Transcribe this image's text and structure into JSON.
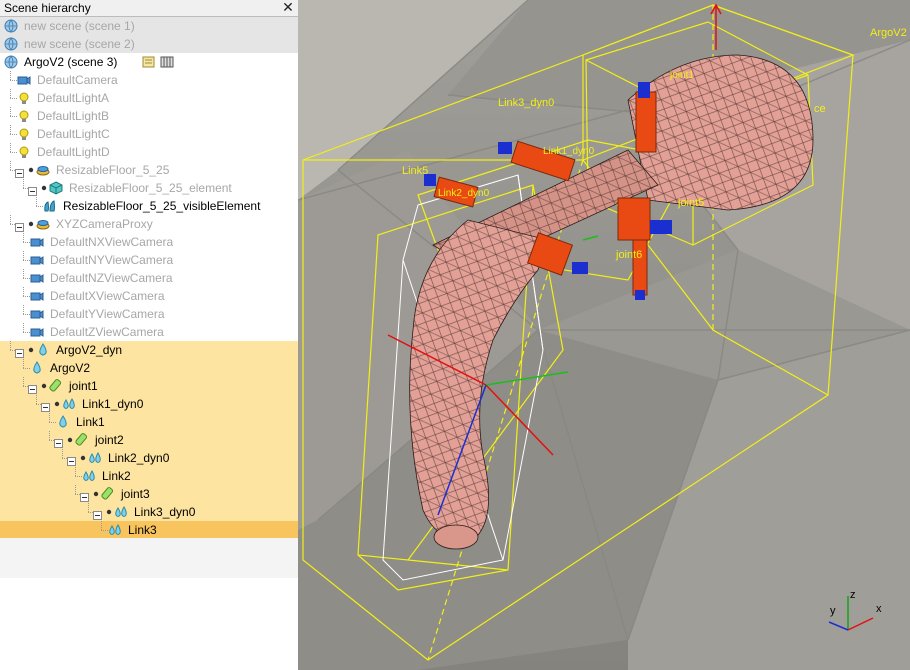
{
  "panel": {
    "title": "Scene hierarchy",
    "close": "✕"
  },
  "tree": [
    {
      "label": "new scene (scene 1)",
      "icon": "globe-icon",
      "level": 0,
      "dim": true,
      "bg": "grey"
    },
    {
      "label": "new scene (scene 2)",
      "icon": "globe-icon",
      "level": 0,
      "dim": true,
      "bg": "grey"
    },
    {
      "label": "ArgoV2 (scene 3)",
      "icon": "globe-icon",
      "level": 0,
      "dim": false,
      "bg": "",
      "extras": true
    },
    {
      "label": "DefaultCamera",
      "icon": "camera-icon",
      "level": 1,
      "dim": true,
      "bg": ""
    },
    {
      "label": "DefaultLightA",
      "icon": "light-icon",
      "level": 1,
      "dim": true,
      "bg": ""
    },
    {
      "label": "DefaultLightB",
      "icon": "light-icon",
      "level": 1,
      "dim": true,
      "bg": ""
    },
    {
      "label": "DefaultLightC",
      "icon": "light-icon",
      "level": 1,
      "dim": true,
      "bg": ""
    },
    {
      "label": "DefaultLightD",
      "icon": "light-icon",
      "level": 1,
      "dim": true,
      "bg": ""
    },
    {
      "label": "ResizableFloor_5_25",
      "icon": "floor-icon",
      "level": 1,
      "dim": true,
      "bg": "",
      "exp": true
    },
    {
      "label": "ResizableFloor_5_25_element",
      "icon": "cube-icon",
      "level": 2,
      "dim": true,
      "bg": "",
      "exp": true
    },
    {
      "label": "ResizableFloor_5_25_visibleElement",
      "icon": "shape-icon",
      "level": 3,
      "dim": false,
      "bg": ""
    },
    {
      "label": "XYZCameraProxy",
      "icon": "floor-icon",
      "level": 1,
      "dim": true,
      "bg": "",
      "exp": true
    },
    {
      "label": "DefaultNXViewCamera",
      "icon": "camera-icon",
      "level": 2,
      "dim": true,
      "bg": ""
    },
    {
      "label": "DefaultNYViewCamera",
      "icon": "camera-icon",
      "level": 2,
      "dim": true,
      "bg": ""
    },
    {
      "label": "DefaultNZViewCamera",
      "icon": "camera-icon",
      "level": 2,
      "dim": true,
      "bg": ""
    },
    {
      "label": "DefaultXViewCamera",
      "icon": "camera-icon",
      "level": 2,
      "dim": true,
      "bg": ""
    },
    {
      "label": "DefaultYViewCamera",
      "icon": "camera-icon",
      "level": 2,
      "dim": true,
      "bg": ""
    },
    {
      "label": "DefaultZViewCamera",
      "icon": "camera-icon",
      "level": 2,
      "dim": true,
      "bg": ""
    },
    {
      "label": "ArgoV2_dyn",
      "icon": "drop-icon",
      "level": 1,
      "dim": false,
      "bg": "hl",
      "exp": true
    },
    {
      "label": "ArgoV2",
      "icon": "drop-icon",
      "level": 2,
      "dim": false,
      "bg": "hl"
    },
    {
      "label": "joint1",
      "icon": "joint-icon",
      "level": 2,
      "dim": false,
      "bg": "hl",
      "exp": true
    },
    {
      "label": "Link1_dyn0",
      "icon": "drops-icon",
      "level": 3,
      "dim": false,
      "bg": "hl",
      "exp": true
    },
    {
      "label": "Link1",
      "icon": "drop-icon",
      "level": 4,
      "dim": false,
      "bg": "hl"
    },
    {
      "label": "joint2",
      "icon": "joint-icon",
      "level": 4,
      "dim": false,
      "bg": "hl",
      "exp": true
    },
    {
      "label": "Link2_dyn0",
      "icon": "drops-icon",
      "level": 5,
      "dim": false,
      "bg": "hl",
      "exp": true
    },
    {
      "label": "Link2",
      "icon": "drops-icon",
      "level": 6,
      "dim": false,
      "bg": "hl"
    },
    {
      "label": "joint3",
      "icon": "joint-icon",
      "level": 6,
      "dim": false,
      "bg": "hl",
      "exp": true
    },
    {
      "label": "Link3_dyn0",
      "icon": "drops-icon",
      "level": 7,
      "dim": false,
      "bg": "hl",
      "exp": true
    },
    {
      "label": "Link3",
      "icon": "drops-icon",
      "level": 8,
      "dim": false,
      "bg": "sel"
    }
  ],
  "viewport": {
    "labels": {
      "argo": "ArgoV2",
      "joint1": "joint1",
      "link3dyn": "Link3_dyn0",
      "link1dyn": "Link1_dyn0",
      "link5": "Link5",
      "link2dyn": "Link2_dyn0",
      "joint5": "joint5",
      "joint6": "joint6",
      "fragment_ce": "ce"
    },
    "axis": {
      "x": "x",
      "y": "y",
      "z": "z"
    }
  },
  "colors": {
    "bbox": "#f2ef16",
    "robot": "#e2a096",
    "actuator": "#e94a14",
    "cap": "#1b2fd0",
    "highlight": "#fde4a0",
    "selected": "#f7c45e"
  }
}
